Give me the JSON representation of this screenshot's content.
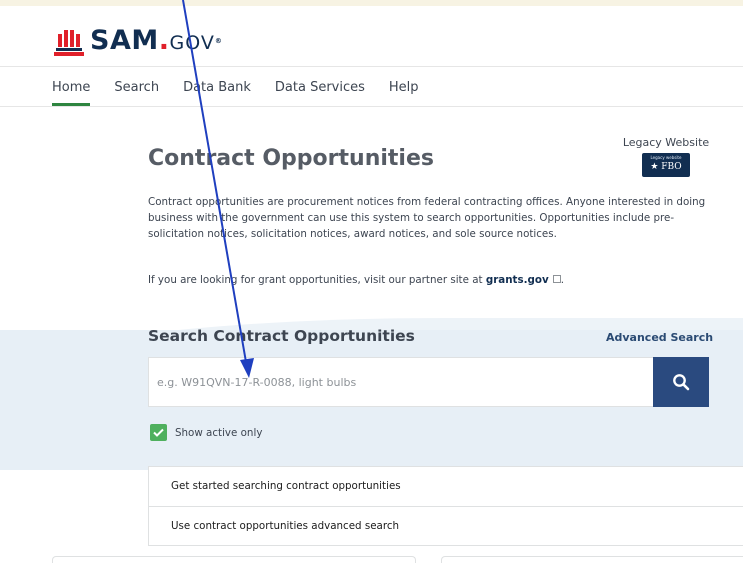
{
  "brand": {
    "name": "SAM",
    "dot": ".",
    "suffix": "GOV",
    "reg": "®"
  },
  "nav": {
    "items": [
      "Home",
      "Search",
      "Data Bank",
      "Data Services",
      "Help"
    ],
    "active": "Home"
  },
  "legacy": {
    "label": "Legacy Website",
    "badge_small": "Legacy website",
    "badge_text": "★ FBO"
  },
  "page": {
    "title": "Contract Opportunities",
    "description": "Contract opportunities are procurement notices from federal contracting offices. Anyone interested in doing business with the government can use this system to search opportunities. Opportunities include pre-solicitation notices, solicitation notices, award notices, and sole source notices.",
    "grant_prefix": "If you are looking for grant opportunities, visit our partner site at ",
    "grant_link": "grants.gov",
    "grant_suffix": "."
  },
  "search": {
    "title": "Search Contract Opportunities",
    "advanced_label": "Advanced Search",
    "placeholder": "e.g. W91QVN-17-R-0088, light bulbs",
    "value": "",
    "active_only_label": "Show active only",
    "active_only_checked": true
  },
  "panel": {
    "items": [
      "Get started searching contract opportunities",
      "Use contract opportunities advanced search"
    ]
  },
  "colors": {
    "brand_navy": "#112e51",
    "brand_red": "#e0202a",
    "active_tab": "#2e8540",
    "search_button": "#2a4a7f",
    "checkbox": "#4fb05e",
    "annotation_arrow": "#1f3fbf"
  },
  "icons": {
    "logo": "capitol-flag-logo",
    "search": "search-icon",
    "check": "check-icon",
    "external": "external-link-icon"
  }
}
